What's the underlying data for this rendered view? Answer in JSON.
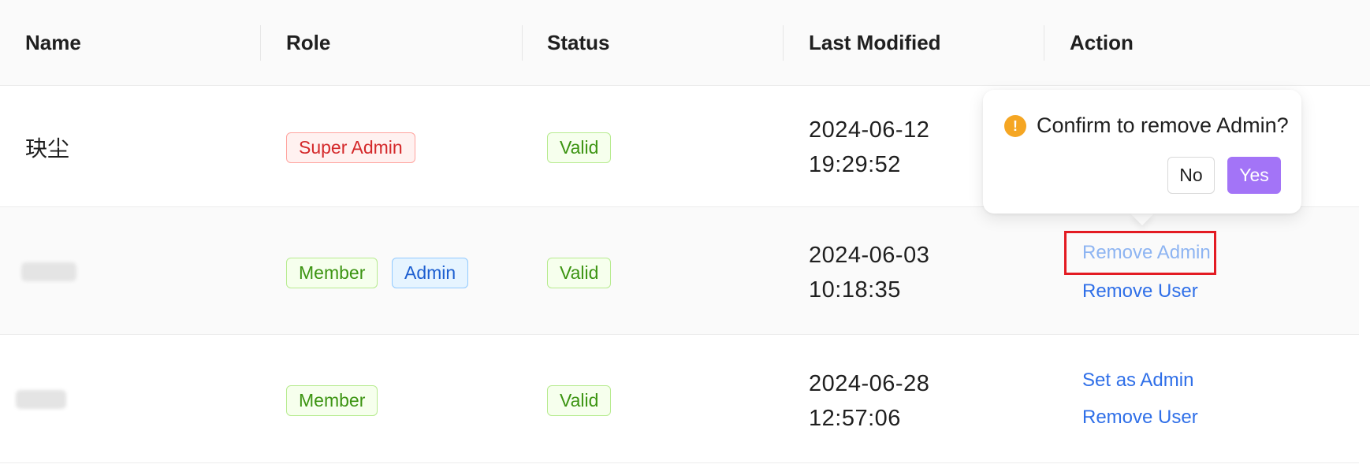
{
  "table": {
    "columns": [
      "Name",
      "Role",
      "Status",
      "Last Modified",
      "Action"
    ],
    "rows": [
      {
        "name": "玦尘",
        "roles": [
          {
            "label": "Super Admin",
            "color": "red"
          }
        ],
        "status": "Valid",
        "date": "2024-06-12",
        "time": "19:29:52",
        "actions": []
      },
      {
        "name": "",
        "roles": [
          {
            "label": "Member",
            "color": "green"
          },
          {
            "label": "Admin",
            "color": "blue"
          }
        ],
        "status": "Valid",
        "date": "2024-06-03",
        "time": "10:18:35",
        "actions": [
          "Remove Admin",
          "Remove User"
        ]
      },
      {
        "name": "",
        "roles": [
          {
            "label": "Member",
            "color": "green"
          }
        ],
        "status": "Valid",
        "date": "2024-06-28",
        "time": "12:57:06",
        "actions": [
          "Set as Admin",
          "Remove User"
        ]
      }
    ]
  },
  "popover": {
    "icon": "warning-icon",
    "message": "Confirm to remove Admin?",
    "cancel_label": "No",
    "confirm_label": "Yes"
  },
  "colors": {
    "link": "#2f6fe8",
    "confirm_button": "#a374f7",
    "warning_icon": "#f5a623",
    "highlight": "#e31b23"
  }
}
